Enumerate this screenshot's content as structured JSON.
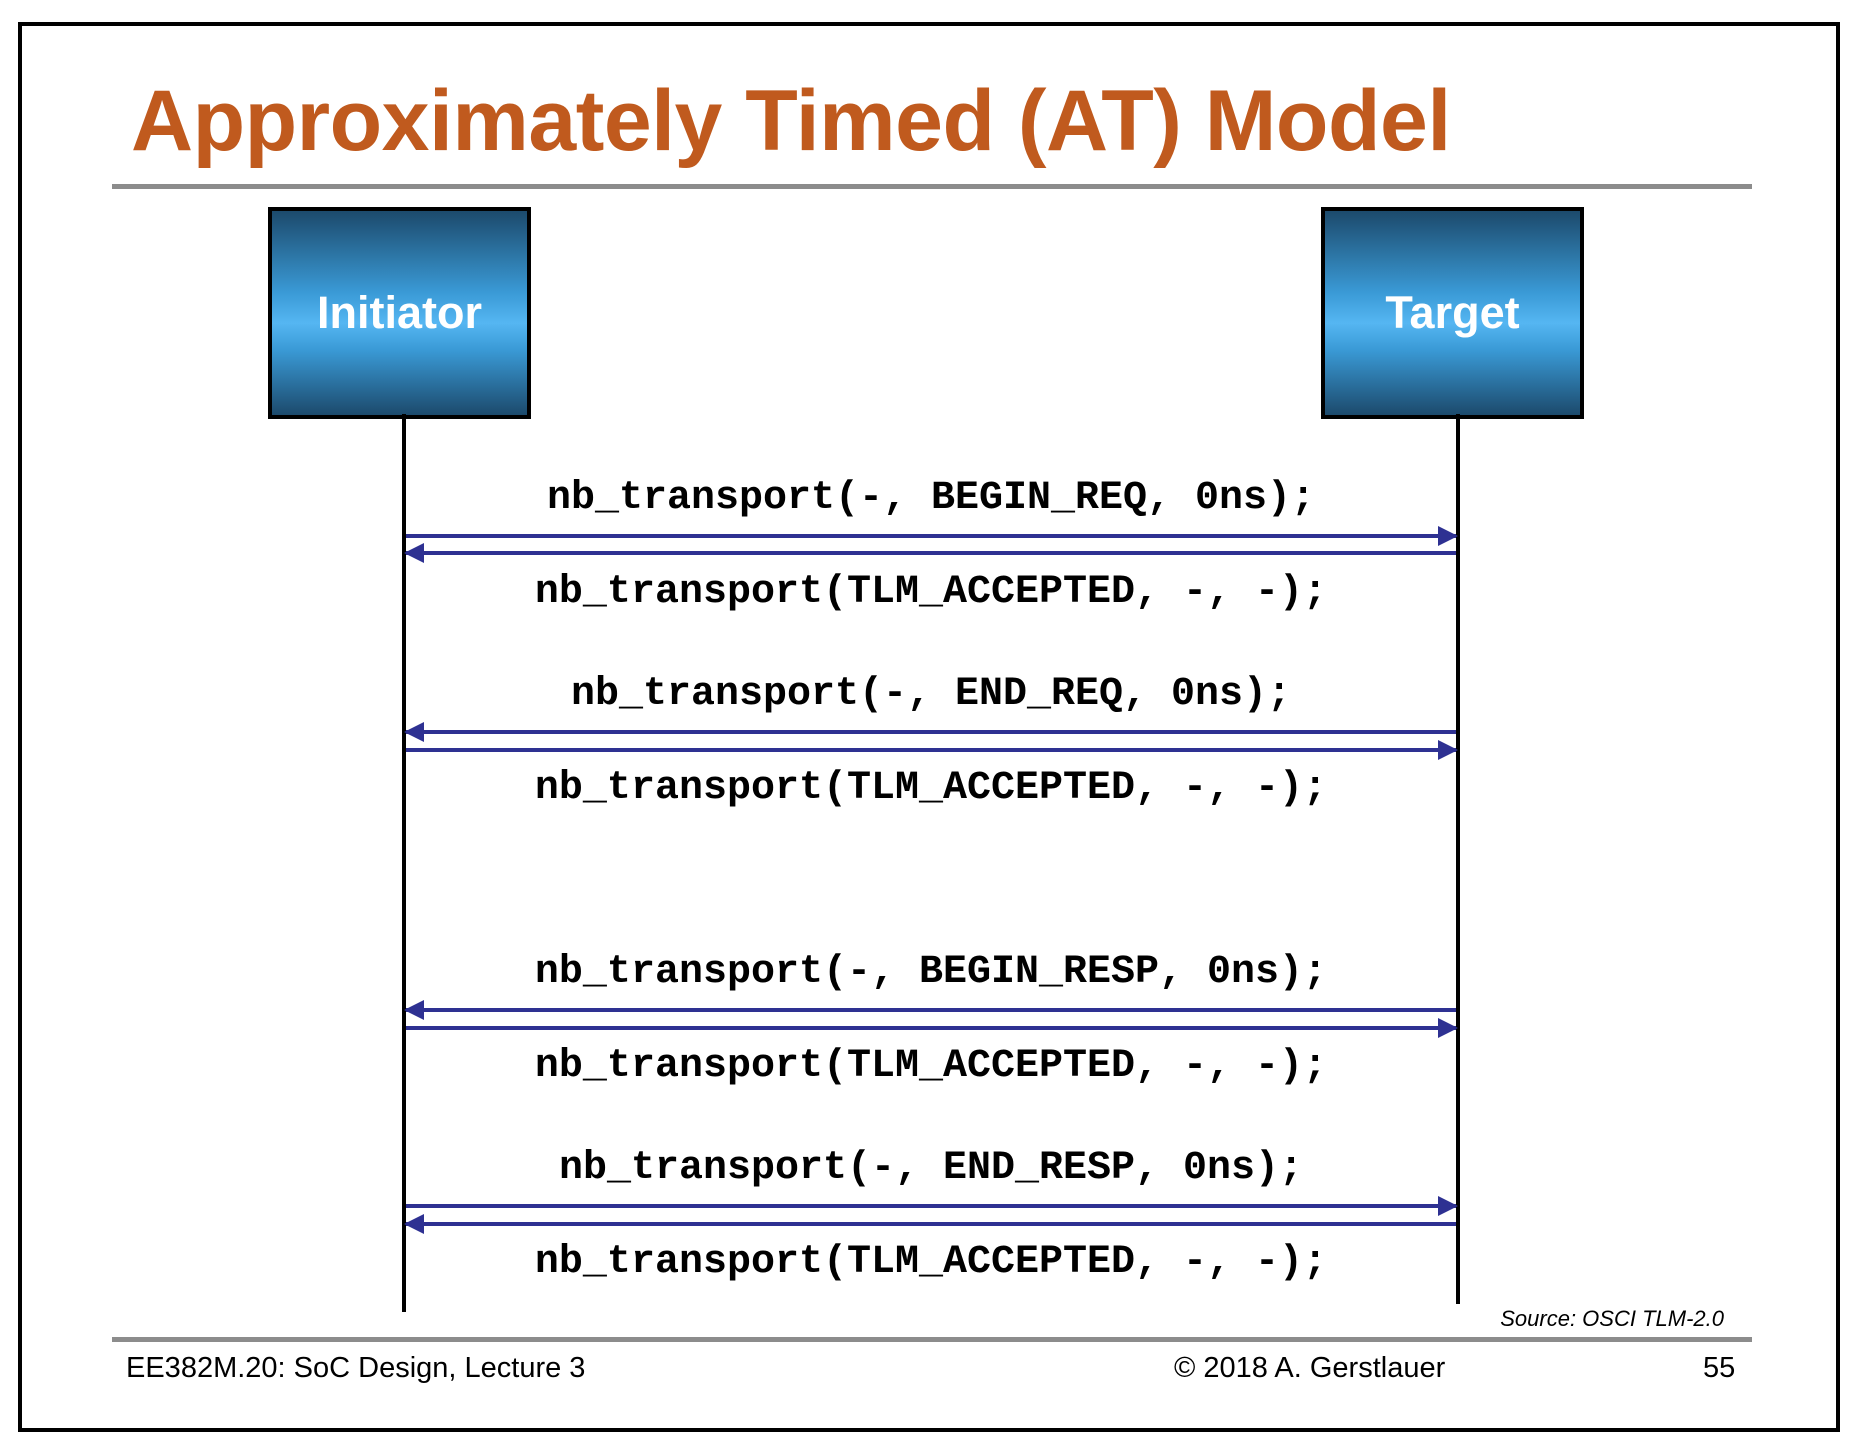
{
  "slide": {
    "title": "Approximately Timed (AT) Model",
    "source": "Source: OSCI TLM-2.0",
    "footer": {
      "course": "EE382M.20: SoC Design, Lecture 3",
      "copyright": "© 2018 A. Gerstlauer",
      "page": "55"
    }
  },
  "actors": {
    "initiator": "Initiator",
    "target": "Target"
  },
  "colors": {
    "title": "#c05a1e",
    "arrow": "#2e3192",
    "actor_fill": "#3a9ad6",
    "rule": "#8c8c8c"
  },
  "messages": [
    {
      "label": "nb_transport(-, BEGIN_REQ, 0ns);",
      "direction": "initiator-to-target"
    },
    {
      "label": "nb_transport(TLM_ACCEPTED, -, -);",
      "direction": "target-to-initiator"
    },
    {
      "label": "nb_transport(-, END_REQ, 0ns);",
      "direction": "target-to-initiator"
    },
    {
      "label": "nb_transport(TLM_ACCEPTED, -, -);",
      "direction": "initiator-to-target"
    },
    {
      "label": "nb_transport(-, BEGIN_RESP, 0ns);",
      "direction": "target-to-initiator"
    },
    {
      "label": "nb_transport(TLM_ACCEPTED, -, -);",
      "direction": "initiator-to-target"
    },
    {
      "label": "nb_transport(-, END_RESP, 0ns);",
      "direction": "initiator-to-target"
    },
    {
      "label": "nb_transport(TLM_ACCEPTED, -, -);",
      "direction": "target-to-initiator"
    }
  ]
}
